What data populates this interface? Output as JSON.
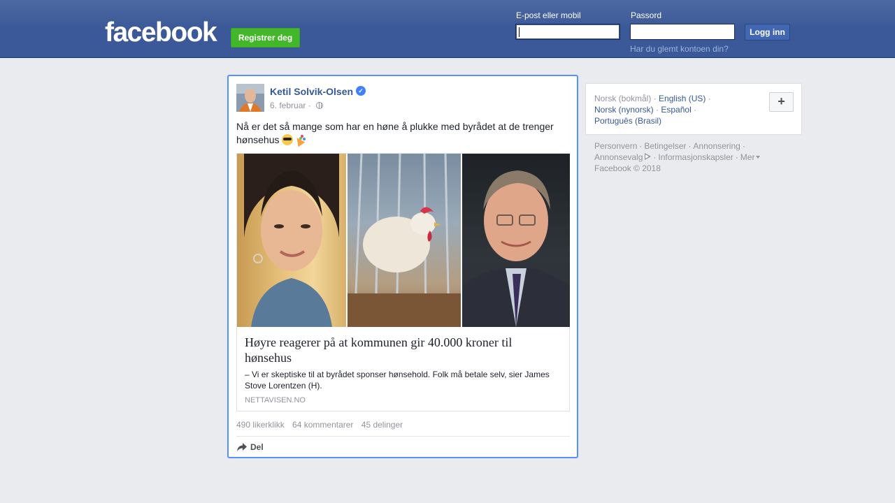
{
  "header": {
    "logo": "facebook",
    "signup_label": "Registrer deg",
    "email_label": "E-post eller mobil",
    "password_label": "Passord",
    "login_label": "Logg inn",
    "forgot_label": "Har du glemt kontoen din?"
  },
  "post": {
    "author": "Ketil Solvik-Olsen",
    "date": "6. februar",
    "date_sep": "·",
    "text": "Nå er det så mange som har en høne å plukke med byrådet at de trenger hønsehus",
    "link": {
      "title": "Høyre reagerer på at kommunen gir 40.000 kroner til hønsehus",
      "description": "– Vi er skeptiske til at byrådet sponser hønsehold. Folk må betale selv, sier James Stove Lorentzen (H).",
      "domain": "NETTAVISEN.NO"
    },
    "likes": "490 likerklikk",
    "comments": "64 kommentarer",
    "shares": "45 delinger",
    "share_label": "Del"
  },
  "languages": {
    "current": "Norsk (bokmål)",
    "options": [
      "English (US)",
      "Norsk (nynorsk)",
      "Español",
      "Português (Brasil)"
    ],
    "separator": "·",
    "add_label": "+"
  },
  "footer": {
    "links": [
      "Personvern",
      "Betingelser",
      "Annonsering",
      "Annonsevalg",
      "Informasjonskapsler",
      "Mer"
    ],
    "copyright": "Facebook © 2018"
  },
  "colors": {
    "brand": "#3b5998",
    "signup_green": "#42b72a",
    "link_blue": "#365899",
    "focus_border": "#5890ff"
  }
}
